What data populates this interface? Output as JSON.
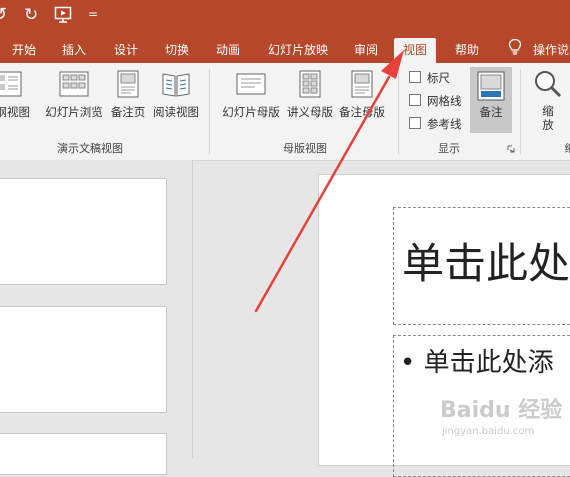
{
  "colors": {
    "accent": "#b7472a",
    "ribbon_bg": "#f3f3f3",
    "arrow": "#e8413c"
  },
  "quick_access": {
    "icons": [
      "undo-icon",
      "redo-icon",
      "present-from-beginning-icon",
      "customize-dropdown-icon"
    ],
    "dropdown_glyph": "="
  },
  "tabs": [
    "开始",
    "插入",
    "设计",
    "切换",
    "动画",
    "幻灯片放映",
    "审阅",
    "视图",
    "帮助",
    "操作说明"
  ],
  "active_tab": "视图",
  "ribbon": {
    "presentation_views": {
      "buttons": [
        "大纲视图",
        "幻灯片浏览",
        "备注页",
        "阅读视图"
      ],
      "label": "演示文稿视图"
    },
    "master_views": {
      "buttons": [
        "幻灯片母版",
        "讲义母版",
        "备注母版"
      ],
      "label": "母版视图"
    },
    "show": {
      "checkboxes": [
        "标尺",
        "网格线",
        "参考线"
      ],
      "notes_button": "备注",
      "label": "显示"
    },
    "zoom": {
      "button": "缩放",
      "label": "缩"
    }
  },
  "slide": {
    "title_placeholder": "单击此处",
    "body_placeholder": "• 单击此处添"
  },
  "watermark": {
    "brand": "Baidu 经验",
    "url": "jingyan.baidu.com"
  }
}
